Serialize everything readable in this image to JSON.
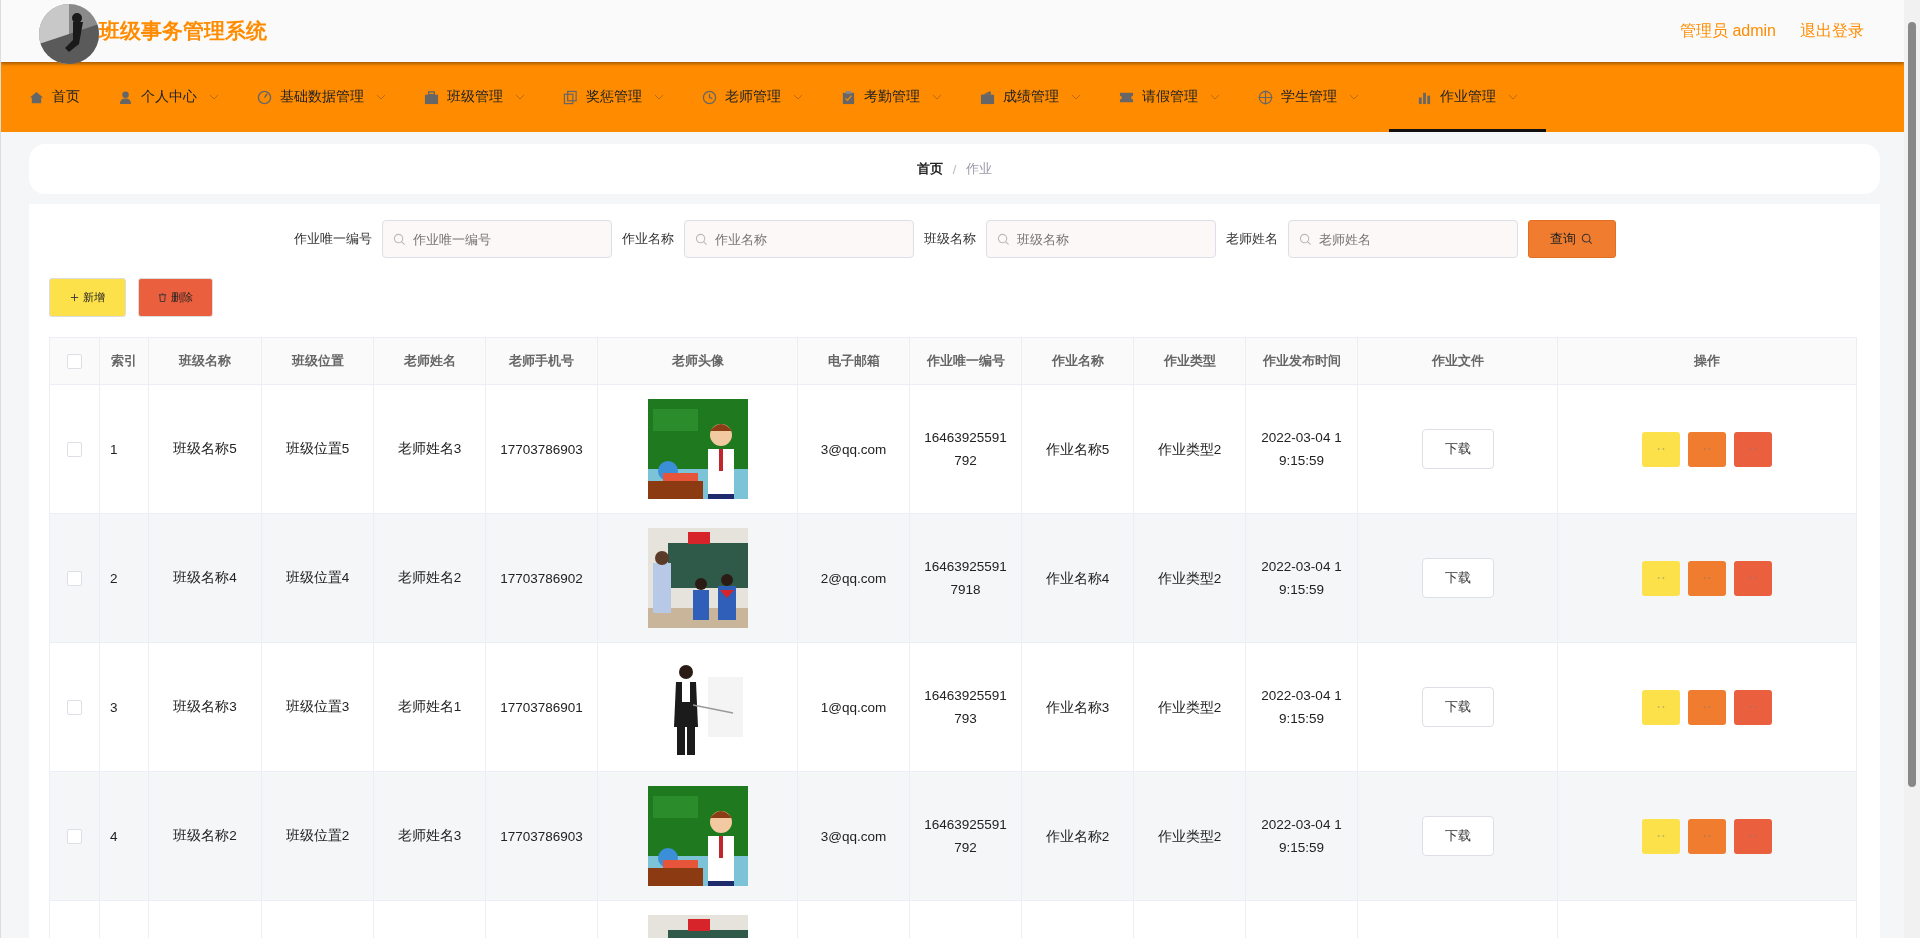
{
  "header": {
    "title": "班级事务管理系统",
    "user": "管理员 admin",
    "logout": "退出登录"
  },
  "nav": [
    {
      "label": "首页",
      "has_caret": false,
      "selected": false
    },
    {
      "label": "个人中心",
      "has_caret": true,
      "selected": false
    },
    {
      "label": "基础数据管理",
      "has_caret": true,
      "selected": false
    },
    {
      "label": "班级管理",
      "has_caret": true,
      "selected": false
    },
    {
      "label": "奖惩管理",
      "has_caret": true,
      "selected": false
    },
    {
      "label": "老师管理",
      "has_caret": true,
      "selected": false
    },
    {
      "label": "考勤管理",
      "has_caret": true,
      "selected": false
    },
    {
      "label": "成绩管理",
      "has_caret": true,
      "selected": false
    },
    {
      "label": "请假管理",
      "has_caret": true,
      "selected": false
    },
    {
      "label": "学生管理",
      "has_caret": true,
      "selected": false
    },
    {
      "label": "作业管理",
      "has_caret": true,
      "selected": true
    }
  ],
  "breadcrumb": {
    "items": [
      "首页",
      "作业"
    ],
    "separator": "/"
  },
  "search": {
    "fields": [
      {
        "label": "作业唯一编号",
        "placeholder": "作业唯一编号"
      },
      {
        "label": "作业名称",
        "placeholder": "作业名称"
      },
      {
        "label": "班级名称",
        "placeholder": "班级名称"
      },
      {
        "label": "老师姓名",
        "placeholder": "老师姓名"
      }
    ],
    "button": "查询"
  },
  "actions": [
    {
      "label": "新增",
      "kind": "add"
    },
    {
      "label": "删除",
      "kind": "delete"
    }
  ],
  "table": {
    "select_all_checked": false,
    "columns": [
      "索引",
      "班级名称",
      "班级位置",
      "老师姓名",
      "老师手机号",
      "老师头像",
      "电子邮箱",
      "作业唯一编号",
      "作业名称",
      "作业类型",
      "作业发布时间",
      "作业文件",
      "操作"
    ],
    "rows": [
      {
        "checked": false,
        "cells": [
          "1",
          "班级名称5",
          "班级位置5",
          "老师姓名3",
          "17703786903"
        ],
        "avatar": {
          "kind": "picture"
        },
        "cells2": [
          "3@qq.com",
          "16463925591792",
          "作业名称5",
          "作业类型2",
          "2022-03-04 19:15:59"
        ],
        "file": "下载"
      },
      {
        "checked": false,
        "cells": [
          "2",
          "班级名称4",
          "班级位置4",
          "老师姓名2",
          "17703786902"
        ],
        "avatar": {
          "kind": "picture"
        },
        "cells2": [
          "2@qq.com",
          "164639255917918",
          "作业名称4",
          "作业类型2",
          "2022-03-04 19:15:59"
        ],
        "file": "下载"
      },
      {
        "checked": false,
        "cells": [
          "3",
          "班级名称3",
          "班级位置3",
          "老师姓名1",
          "17703786901"
        ],
        "avatar": {
          "kind": "picture"
        },
        "cells2": [
          "1@qq.com",
          "16463925591793",
          "作业名称3",
          "作业类型2",
          "2022-03-04 19:15:59"
        ],
        "file": "下载"
      },
      {
        "checked": false,
        "cells": [
          "4",
          "班级名称2",
          "班级位置2",
          "老师姓名3",
          "17703786903"
        ],
        "avatar": {
          "kind": "picture"
        },
        "cells2": [
          "3@qq.com",
          "16463925591792",
          "作业名称2",
          "作业类型2",
          "2022-03-04 19:15:59"
        ],
        "file": "下载"
      },
      {
        "avatar": {
          "kind": "picture"
        }
      }
    ]
  }
}
